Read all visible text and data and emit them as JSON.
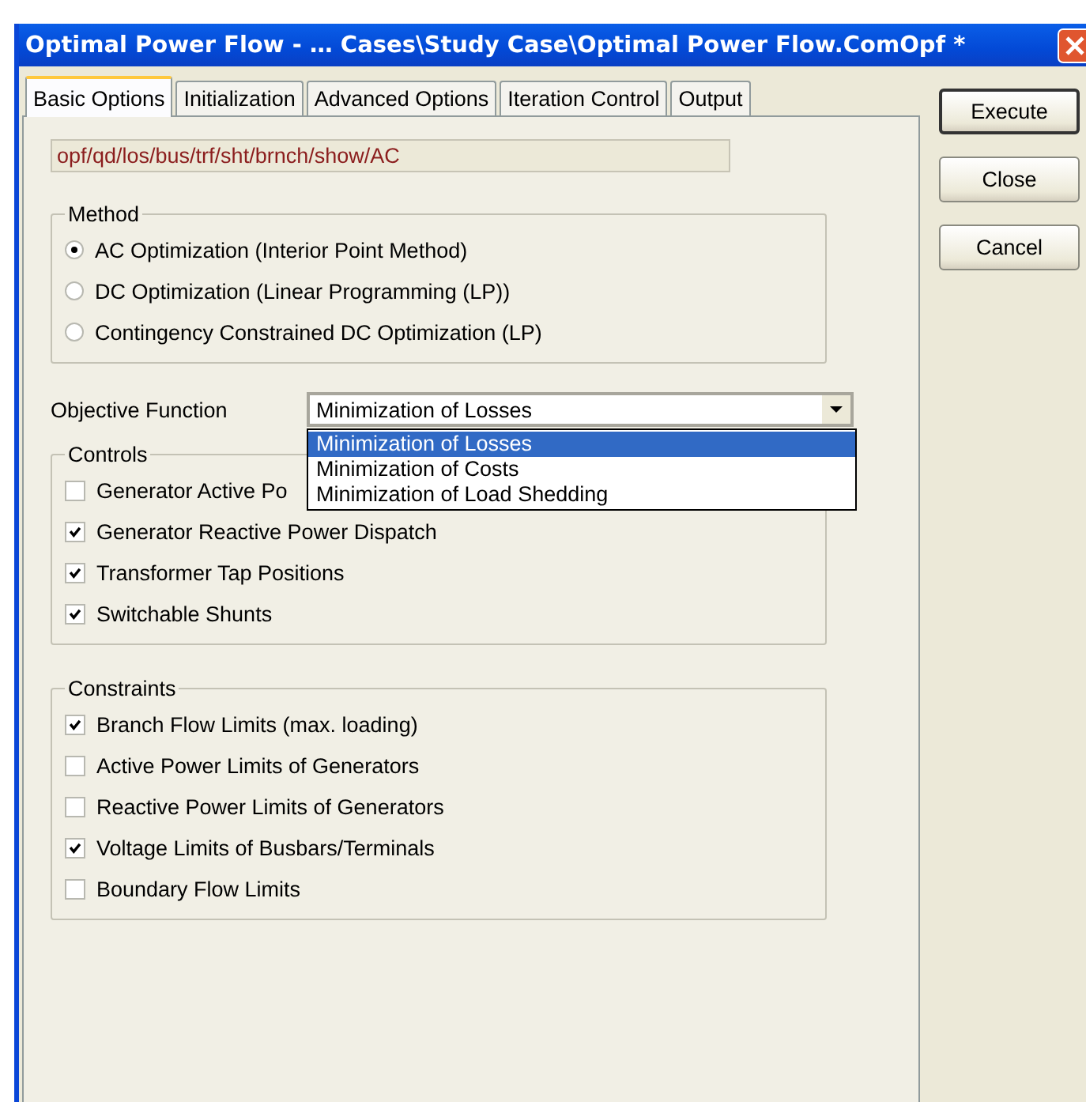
{
  "window": {
    "title": "Optimal Power Flow - … Cases\\Study Case\\Optimal Power Flow.ComOpf *"
  },
  "tabs": [
    {
      "label": "Basic Options",
      "selected": true
    },
    {
      "label": "Initialization",
      "selected": false
    },
    {
      "label": "Advanced Options",
      "selected": false
    },
    {
      "label": "Iteration Control",
      "selected": false
    },
    {
      "label": "Output",
      "selected": false
    }
  ],
  "command_field": {
    "value": "opf/qd/los/bus/trf/sht/brnch/show/AC"
  },
  "method": {
    "title": "Method",
    "options": [
      {
        "label": "AC Optimization (Interior Point Method)",
        "selected": true
      },
      {
        "label": "DC Optimization (Linear Programming (LP))",
        "selected": false
      },
      {
        "label": "Contingency Constrained DC Optimization (LP)",
        "selected": false
      }
    ]
  },
  "objective": {
    "label": "Objective Function",
    "value": "Minimization of Losses",
    "expanded": true,
    "options": [
      {
        "label": "Minimization of Losses",
        "selected": true
      },
      {
        "label": "Minimization of Costs",
        "selected": false
      },
      {
        "label": "Minimization of Load Shedding",
        "selected": false
      }
    ]
  },
  "controls": {
    "title": "Controls",
    "items": [
      {
        "label": "Generator Active Po",
        "checked": false
      },
      {
        "label": "Generator Reactive Power Dispatch",
        "checked": true
      },
      {
        "label": "Transformer Tap Positions",
        "checked": true
      },
      {
        "label": "Switchable Shunts",
        "checked": true
      }
    ]
  },
  "constraints": {
    "title": "Constraints",
    "items": [
      {
        "label": "Branch Flow Limits (max. loading)",
        "checked": true
      },
      {
        "label": "Active Power Limits of Generators",
        "checked": false
      },
      {
        "label": "Reactive Power Limits of Generators",
        "checked": false
      },
      {
        "label": "Voltage Limits of Busbars/Terminals",
        "checked": true
      },
      {
        "label": "Boundary Flow Limits",
        "checked": false
      }
    ]
  },
  "buttons": [
    {
      "label": "Execute",
      "default": true
    },
    {
      "label": "Close",
      "default": false
    },
    {
      "label": "Cancel",
      "default": false
    }
  ]
}
